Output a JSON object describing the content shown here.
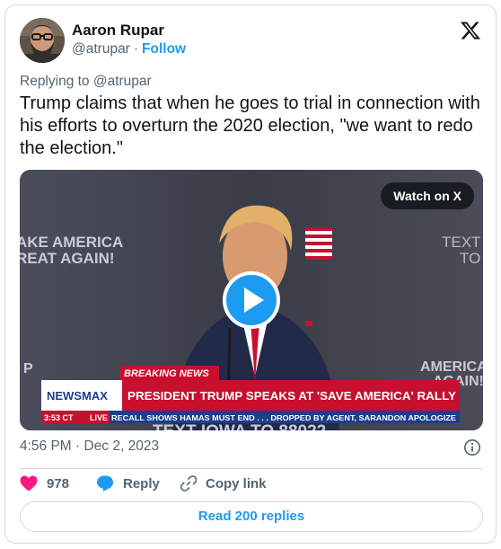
{
  "author": {
    "name": "Aaron Rupar",
    "handle": "@atrupar",
    "separator": "·",
    "follow_label": "Follow"
  },
  "reply_to": "Replying to @atrupar",
  "tweet_text": "Trump claims that when he goes to trial in connection with his efforts to overturn the 2020 election, \"we want to redo the election.\"",
  "media": {
    "watch_label": "Watch on X",
    "backdrop_left": [
      "AKE AMERICA",
      "REAT AGAIN!"
    ],
    "backdrop_right": [
      "TEXT",
      "TO"
    ],
    "backdrop_right_lower": [
      "AMERICA",
      "AGAIN!"
    ],
    "backdrop_p": "P",
    "bottom_text": "TEXT IOWA TO 88022",
    "chyron": {
      "breaking": "BREAKING NEWS",
      "network": "NEWSMAX",
      "headline": "PRESIDENT TRUMP SPEAKS AT 'SAVE AMERICA' RALLY",
      "time": "3:53 CT",
      "live": "LIVE",
      "ticker": "RECALL SHOWS HAMAS MUST END . . .     DROPPED BY AGENT, SARANDON APOLOGIZE"
    }
  },
  "timestamp": "4:56 PM · Dec 2, 2023",
  "actions": {
    "likes": "978",
    "reply": "Reply",
    "copy": "Copy link"
  },
  "read_replies": "Read 200 replies",
  "colors": {
    "accent": "#1d9bf0",
    "like": "#f91880",
    "text_secondary": "#536471",
    "chyron_red": "#c8102e",
    "chyron_navy": "#1c3f8c"
  }
}
